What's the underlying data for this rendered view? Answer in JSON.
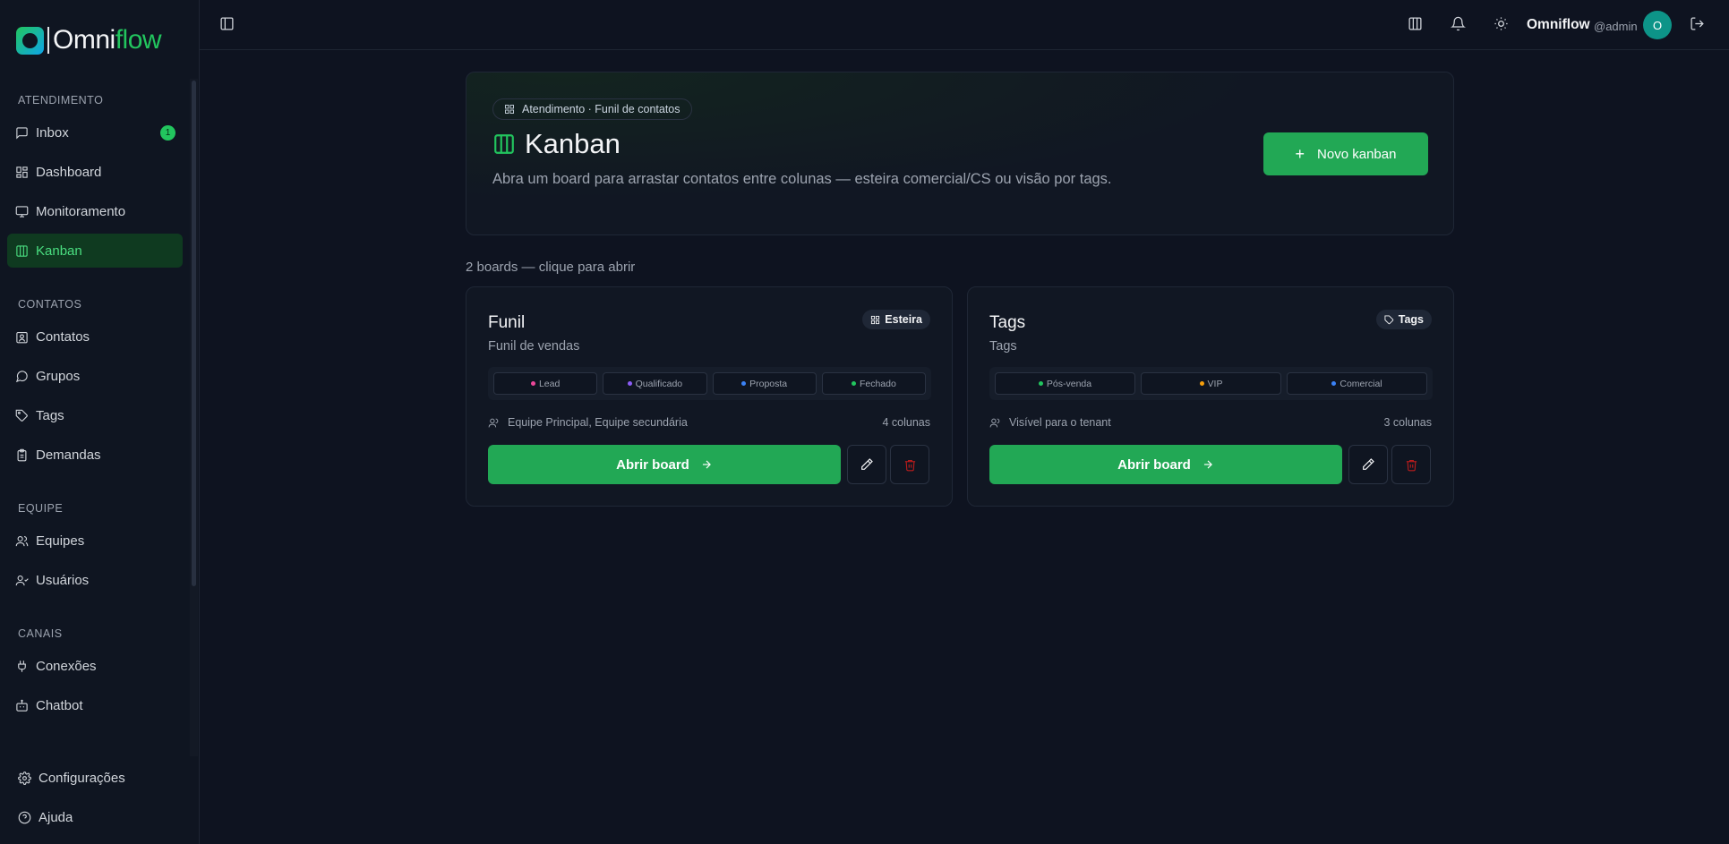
{
  "app": {
    "logo_a": "O",
    "logo_b": "mni",
    "logo_c": "flow"
  },
  "sidebar": {
    "sections": [
      {
        "title": "ATENDIMENTO"
      },
      {
        "title": "CONTATOS"
      },
      {
        "title": "EQUIPE"
      },
      {
        "title": "CANAIS"
      }
    ],
    "items": [
      {
        "label": "Inbox",
        "icon": "message-square-icon",
        "badge": "1"
      },
      {
        "label": "Dashboard",
        "icon": "layout-dashboard-icon"
      },
      {
        "label": "Monitoramento",
        "icon": "monitor-icon"
      },
      {
        "label": "Kanban",
        "icon": "kanban-icon",
        "active": true
      },
      {
        "label": "Contatos",
        "icon": "contact-icon"
      },
      {
        "label": "Grupos",
        "icon": "message-circle-icon"
      },
      {
        "label": "Tags",
        "icon": "tag-icon"
      },
      {
        "label": "Demandas",
        "icon": "clipboard-icon"
      },
      {
        "label": "Equipes",
        "icon": "users-icon"
      },
      {
        "label": "Usuários",
        "icon": "user-icon"
      },
      {
        "label": "Conexões",
        "icon": "plug-icon"
      },
      {
        "label": "Chatbot",
        "icon": "bot-icon"
      }
    ],
    "footer": [
      {
        "label": "Configurações",
        "icon": "gear-icon"
      },
      {
        "label": "Ajuda",
        "icon": "help-circle-icon"
      }
    ]
  },
  "header": {
    "user_name": "Omniflow",
    "user_handle": "@admin",
    "avatar_initial": "O"
  },
  "hero": {
    "breadcrumb": "Atendimento · Funil de contatos",
    "title": "Kanban",
    "description": "Abra um board para arrastar contatos entre colunas — esteira comercial/CS ou visão por tags.",
    "new_button": "Novo kanban"
  },
  "boards_count_text": "2 boards — clique para abrir",
  "boards": [
    {
      "title": "Funil",
      "subtitle": "Funil de vendas",
      "type": "Esteira",
      "columns": [
        {
          "label": "Lead",
          "color": "#ec4899"
        },
        {
          "label": "Qualificado",
          "color": "#8b5cf6"
        },
        {
          "label": "Proposta",
          "color": "#3b82f6"
        },
        {
          "label": "Fechado",
          "color": "#22c55e"
        }
      ],
      "visibility": "Equipe Principal, Equipe secundária",
      "column_count": "4 colunas",
      "open_label": "Abrir board"
    },
    {
      "title": "Tags",
      "subtitle": "Tags",
      "type": "Tags",
      "columns": [
        {
          "label": "Pós-venda",
          "color": "#22c55e"
        },
        {
          "label": "VIP",
          "color": "#f59e0b"
        },
        {
          "label": "Comercial",
          "color": "#3b82f6"
        }
      ],
      "visibility": "Visível para o tenant",
      "column_count": "3 colunas",
      "open_label": "Abrir board"
    }
  ]
}
